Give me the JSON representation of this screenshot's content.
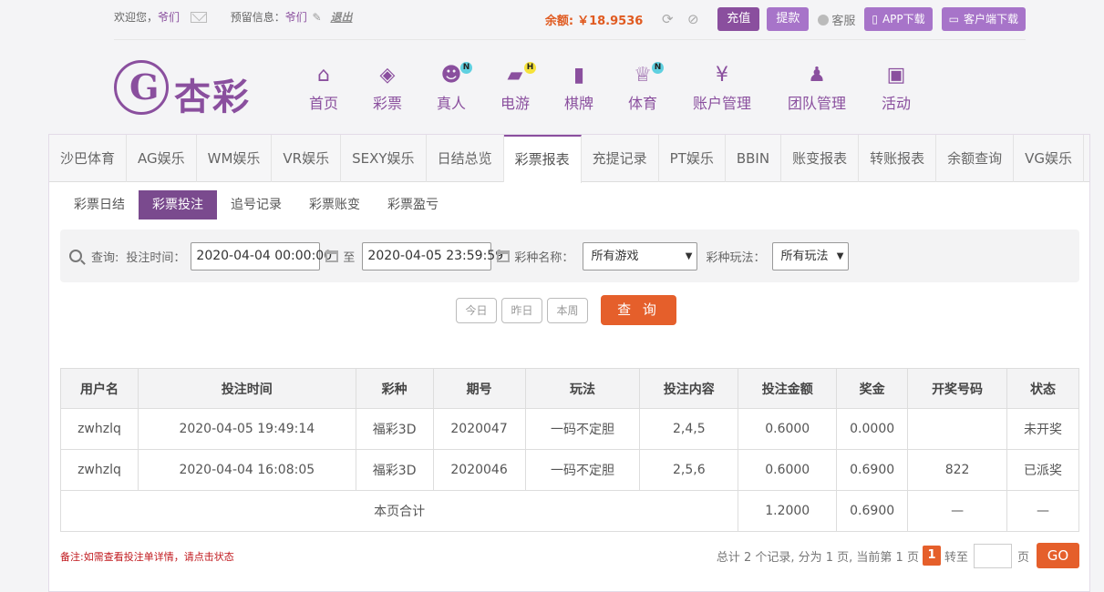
{
  "topbar": {
    "welcome": "欢迎您，",
    "username": "爷们",
    "reserved_label": "预留信息：",
    "reserved_value": "爷们",
    "logout": "退出",
    "balance_label": "余额:",
    "balance_value": "￥18.9536",
    "recharge": "充值",
    "withdraw": "提款",
    "service": "客服",
    "app_download": "APP下载",
    "client_download": "客户端下载"
  },
  "logo": {
    "text": "杏彩"
  },
  "nav": [
    {
      "label": "首页",
      "icon": "home-icon",
      "badge": ""
    },
    {
      "label": "彩票",
      "icon": "lottery-icon",
      "badge": ""
    },
    {
      "label": "真人",
      "icon": "live-dealer-icon",
      "badge": "N"
    },
    {
      "label": "电游",
      "icon": "gamepad-icon",
      "badge": "H"
    },
    {
      "label": "棋牌",
      "icon": "cards-icon",
      "badge": ""
    },
    {
      "label": "体育",
      "icon": "trophy-icon",
      "badge": "N"
    },
    {
      "label": "账户管理",
      "icon": "yen-icon",
      "badge": ""
    },
    {
      "label": "团队管理",
      "icon": "team-icon",
      "badge": ""
    },
    {
      "label": "活动",
      "icon": "gift-icon",
      "badge": ""
    }
  ],
  "tabs": [
    "沙巴体育",
    "AG娱乐",
    "WM娱乐",
    "VR娱乐",
    "SEXY娱乐",
    "日结总览",
    "彩票报表",
    "充提记录",
    "PT娱乐",
    "BBIN",
    "账变报表",
    "转账报表",
    "余额查询",
    "VG娱乐"
  ],
  "active_tab": "彩票报表",
  "subtabs": [
    "彩票日结",
    "彩票投注",
    "追号记录",
    "彩票账变",
    "彩票盈亏"
  ],
  "active_subtab": "彩票投注",
  "search": {
    "query_label": "查询:",
    "time_label": "投注时间：",
    "start": "2020-04-04 00:00:00",
    "to": "至",
    "end": "2020-04-05 23:59:59",
    "game_label": "彩种名称：",
    "game_value": "所有游戏",
    "play_label": "彩种玩法：",
    "play_value": "所有玩法",
    "today": "今日",
    "yesterday": "昨日",
    "week": "本周",
    "submit": "查 询"
  },
  "table": {
    "headers": [
      "用户名",
      "投注时间",
      "彩种",
      "期号",
      "玩法",
      "投注内容",
      "投注金额",
      "奖金",
      "开奖号码",
      "状态"
    ],
    "rows": [
      [
        "zwhzlq",
        "2020-04-05 19:49:14",
        "福彩3D",
        "2020047",
        "一码不定胆",
        "2,4,5",
        "0.6000",
        "0.0000",
        "",
        "未开奖"
      ],
      [
        "zwhzlq",
        "2020-04-04 16:08:05",
        "福彩3D",
        "2020046",
        "一码不定胆",
        "2,5,6",
        "0.6000",
        "0.6900",
        "822",
        "已派奖"
      ]
    ],
    "total_label": "本页合计",
    "total_amount": "1.2000",
    "total_bonus": "0.6900",
    "total_dash1": "—",
    "total_dash2": "—"
  },
  "footer": {
    "note": "备注:如需查看投注单详情，请点击状态",
    "summary": "总计 2 个记录, 分为 1 页, 当前第 1 页",
    "current_page": "1",
    "goto": "转至",
    "page_unit": "页",
    "go": "GO"
  },
  "colors": {
    "brand": "#8a4f9e",
    "accent": "#e55f2b",
    "green": "#2a8a1a"
  }
}
